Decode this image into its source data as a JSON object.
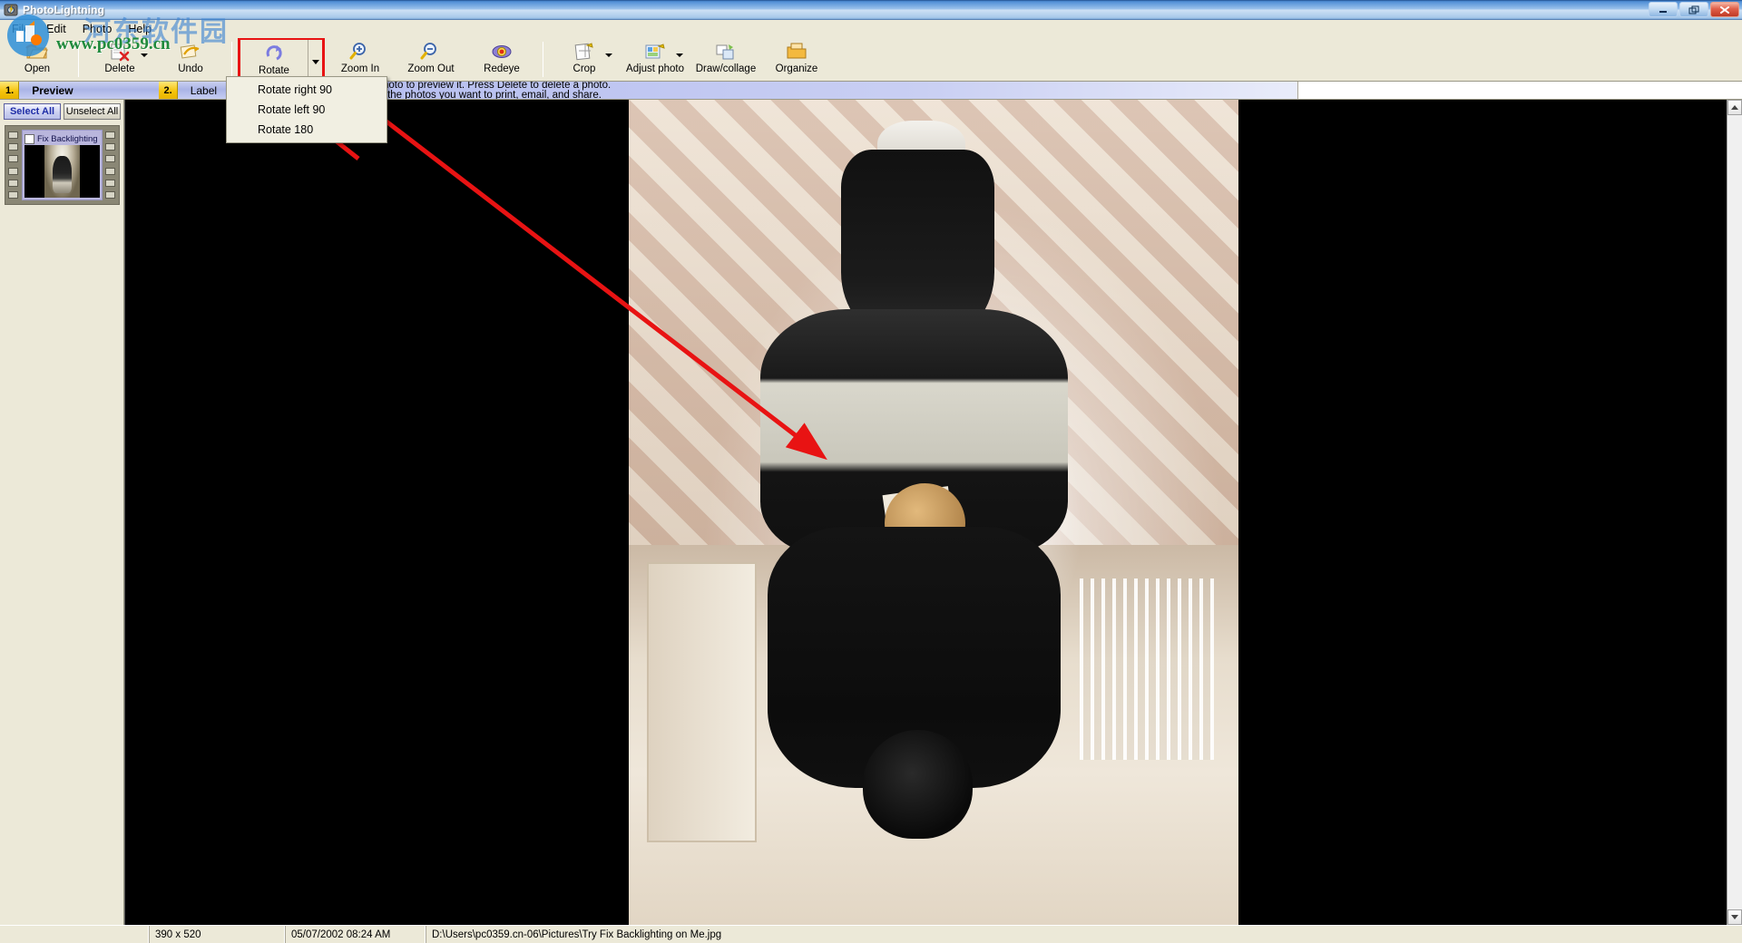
{
  "window": {
    "title": "PhotoLightning",
    "icon": "app-icon",
    "controls": {
      "minimize": "–",
      "restore": "❐",
      "close": "✕"
    }
  },
  "menubar": {
    "items": [
      "File",
      "Edit",
      "Photo",
      "Help"
    ]
  },
  "toolbar": {
    "items": [
      {
        "label": "Open",
        "icon": "open-folder-icon",
        "dropdown": false
      },
      {
        "label": "Delete",
        "icon": "delete-icon",
        "dropdown": true
      },
      {
        "label": "Undo",
        "icon": "undo-icon",
        "dropdown": false
      },
      {
        "label": "Rotate",
        "icon": "rotate-icon",
        "dropdown": true
      },
      {
        "label": "Zoom In",
        "icon": "zoom-in-icon",
        "dropdown": false
      },
      {
        "label": "Zoom Out",
        "icon": "zoom-out-icon",
        "dropdown": false
      },
      {
        "label": "Redeye",
        "icon": "redeye-icon",
        "dropdown": false
      },
      {
        "label": "Crop",
        "icon": "crop-icon",
        "dropdown": true
      },
      {
        "label": "Adjust photo",
        "icon": "adjust-photo-icon",
        "dropdown": true
      },
      {
        "label": "Draw/collage",
        "icon": "draw-collage-icon",
        "dropdown": false
      },
      {
        "label": "Organize",
        "icon": "organize-icon",
        "dropdown": false
      }
    ],
    "highlight_color": "#e81313"
  },
  "rotate_menu": {
    "open": true,
    "items": [
      "Rotate right 90",
      "Rotate left 90",
      "Rotate 180"
    ]
  },
  "steps": [
    {
      "num": "1.",
      "label": "Preview",
      "active": true
    },
    {
      "num": "2.",
      "label": "Label",
      "active": false
    },
    {
      "num": "3.",
      "label": "",
      "active": false
    }
  ],
  "instructions": {
    "line1": "a photo to preview it.  Press Delete to delete a photo.",
    "line2": "lect the photos you want to print, email, and share."
  },
  "leftpanel": {
    "select_all": "Select All",
    "unselect_all": "Unselect All",
    "thumbnail": {
      "label": "Fix Backlighting on",
      "checked": false
    }
  },
  "statusbar": {
    "dimensions": "390 x 520",
    "datetime": "05/07/2002  08:24 AM",
    "path": "D:\\Users\\pc0359.cn-06\\Pictures\\Try Fix Backlighting on Me.jpg"
  },
  "watermark": {
    "domain": "www.pc0359.cn",
    "chinese": "河东软件园"
  },
  "colors": {
    "accent_red": "#e81313",
    "title_blue": "#2f6cb5",
    "step_yellow": "#f5c40d",
    "instruct_blue": "#b7bff0"
  }
}
